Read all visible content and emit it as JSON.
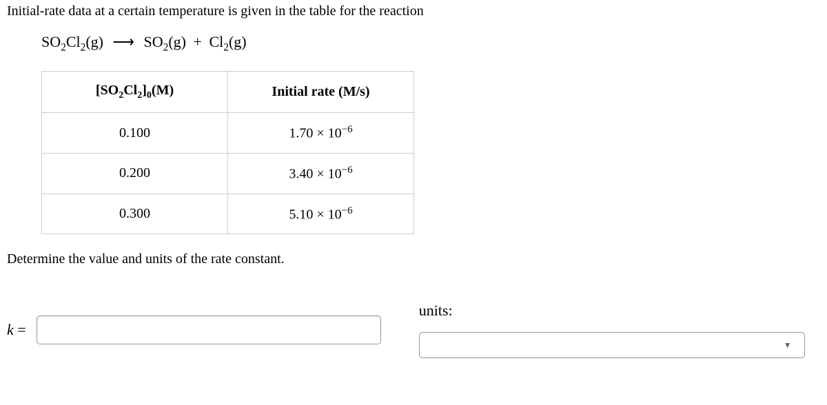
{
  "intro": "Initial-rate data at a certain temperature is given in the table for the reaction",
  "equation": {
    "reactant": "SO",
    "reactant_sub1": "2",
    "reactant_cl": "Cl",
    "reactant_sub2": "2",
    "reactant_phase": "(g)",
    "arrow": "⟶",
    "product1": "SO",
    "product1_sub": "2",
    "product1_phase": "(g)",
    "plus": "+",
    "product2": "Cl",
    "product2_sub": "2",
    "product2_phase": "(g)"
  },
  "table": {
    "header1_pre": "[SO",
    "header1_sub1": "2",
    "header1_mid": "Cl",
    "header1_sub2": "2",
    "header1_post": "]",
    "header1_sub3": "0",
    "header1_unit": "(M)",
    "header2": "Initial rate (M/s)",
    "rows": [
      {
        "conc": "0.100",
        "rate_base": "1.70 × 10",
        "rate_exp": "−6"
      },
      {
        "conc": "0.200",
        "rate_base": "3.40 × 10",
        "rate_exp": "−6"
      },
      {
        "conc": "0.300",
        "rate_base": "5.10 × 10",
        "rate_exp": "−6"
      }
    ]
  },
  "instruction": "Determine the value and units of the rate constant.",
  "answer": {
    "k_label_var": "k",
    "k_label_eq": " =",
    "units_label": "units:"
  }
}
